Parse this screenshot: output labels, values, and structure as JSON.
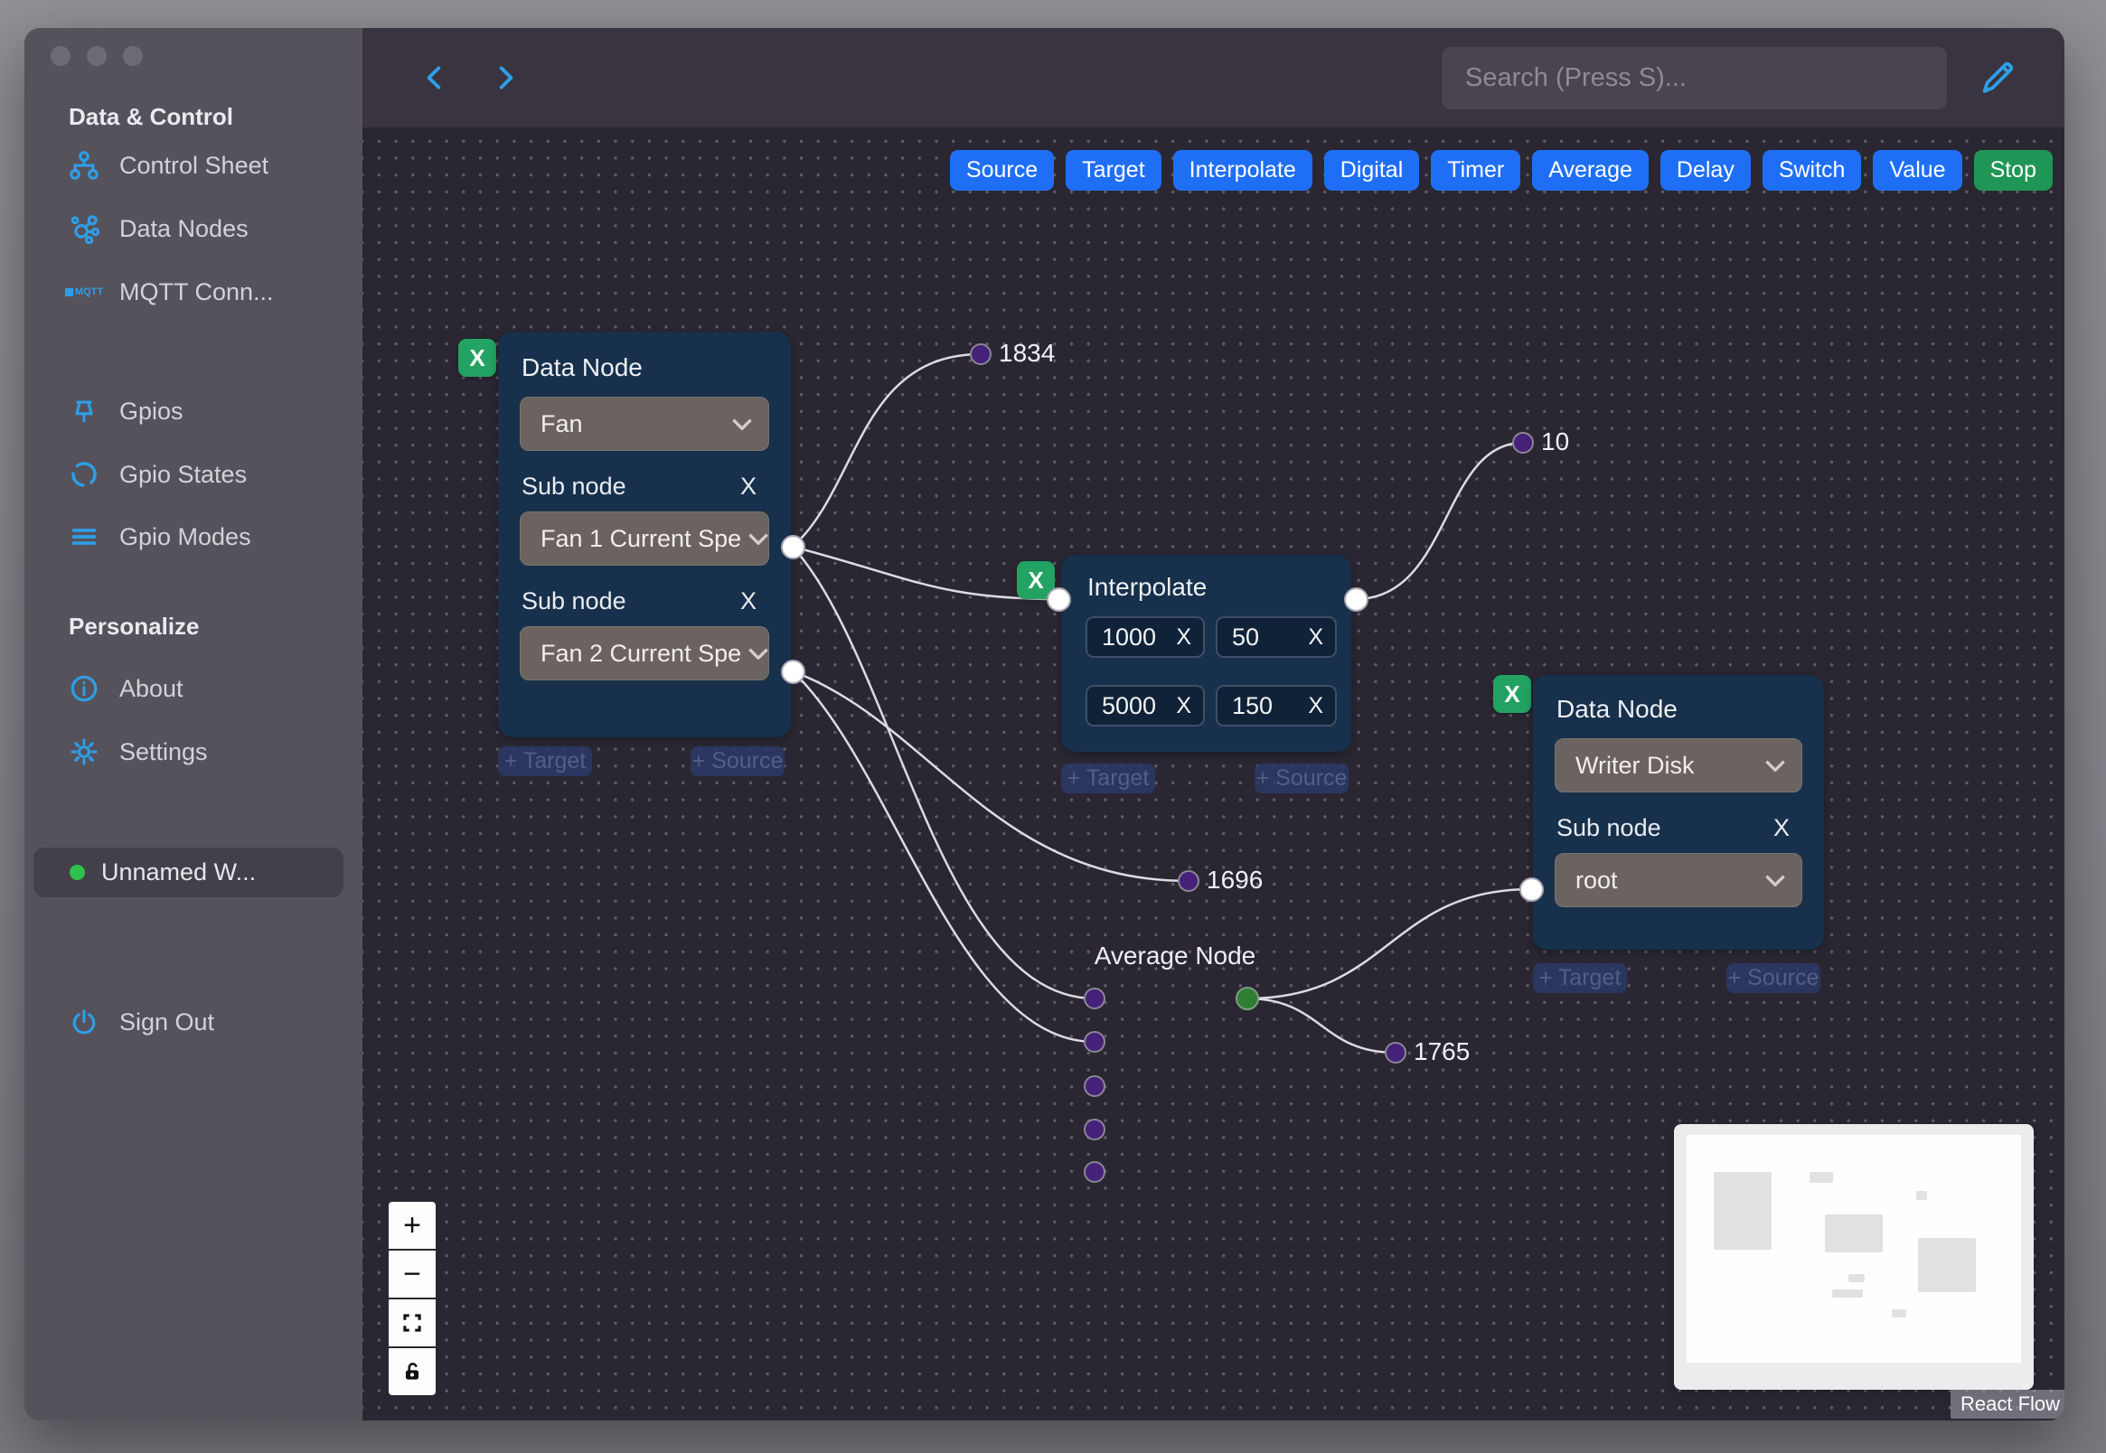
{
  "sidebar": {
    "sections": [
      {
        "header": "Data & Control",
        "items": [
          "Control Sheet",
          "Data Nodes",
          "MQTT Conn..."
        ]
      },
      {
        "header": "",
        "items": [
          "Gpios",
          "Gpio States",
          "Gpio Modes"
        ]
      },
      {
        "header": "Personalize",
        "items": [
          "About",
          "Settings"
        ]
      }
    ],
    "mqtt_badge": "MQTT",
    "workflow": {
      "label": "Unnamed W..."
    },
    "sign_out": "Sign Out"
  },
  "header": {
    "search_placeholder": "Search (Press S)..."
  },
  "toolbar": {
    "buttons": [
      "Source",
      "Target",
      "Interpolate",
      "Digital",
      "Timer",
      "Average",
      "Delay",
      "Switch",
      "Value",
      "Stop"
    ]
  },
  "ui": {
    "remove": "X",
    "target_pill": "+ Target",
    "source_pill": "+ Source",
    "zoom_in": "+",
    "zoom_out": "−"
  },
  "nodes": {
    "fan": {
      "title": "Data Node",
      "device": "Fan",
      "sub_label": "Sub node",
      "sub1": "Fan 1 Current Spe",
      "sub2": "Fan 2 Current Spe"
    },
    "interpolate": {
      "title": "Interpolate",
      "values": [
        "1000",
        "50",
        "5000",
        "150"
      ]
    },
    "writer": {
      "title": "Data Node",
      "device": "Writer Disk",
      "sub_label": "Sub node",
      "sub": "root"
    },
    "average": {
      "title": "Average Node"
    }
  },
  "edge_labels": {
    "fan1_out": "1834",
    "interpolate_out": "10",
    "fan2_out": "1696",
    "average_out": "1765"
  },
  "attribution": "React Flow",
  "colors": {
    "accent_blue": "#1f6ff6",
    "stop_green": "#1f9655",
    "icon_blue": "#2e9fe8",
    "node_bg": "#17304b",
    "handle_purple": "#46217a",
    "handle_green": "#2d7d33",
    "edge": "#dcdbe3"
  }
}
